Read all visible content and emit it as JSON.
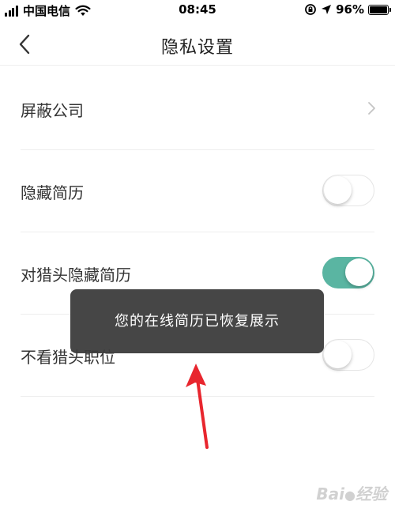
{
  "status_bar": {
    "carrier": "中国电信",
    "time": "08:45",
    "battery": "96%",
    "battery_level": 0.96,
    "icons": [
      "signal-icon",
      "wifi-icon",
      "rotation-lock-icon",
      "location-icon",
      "battery-icon"
    ]
  },
  "nav": {
    "title": "隐私设置",
    "back_icon": "chevron-left-icon"
  },
  "settings": {
    "block_company": {
      "label": "屏蔽公司",
      "icon": "chevron-right-icon"
    },
    "hide_resume": {
      "label": "隐藏简历",
      "toggle_on": false
    },
    "hide_from_headhunter": {
      "label": "对猎头隐藏简历",
      "toggle_on": true
    },
    "hide_headhunter_jobs": {
      "label": "不看猎头职位",
      "toggle_on": false
    }
  },
  "toast": {
    "message": "您的在线简历已恢复展示"
  },
  "annotation": {
    "icon": "red-arrow-icon",
    "color": "#e8262e"
  },
  "colors": {
    "toggle_on": "#5ab5a2",
    "toggle_off_border": "#e5e5e5",
    "toast_bg": "#3c3c3c"
  }
}
